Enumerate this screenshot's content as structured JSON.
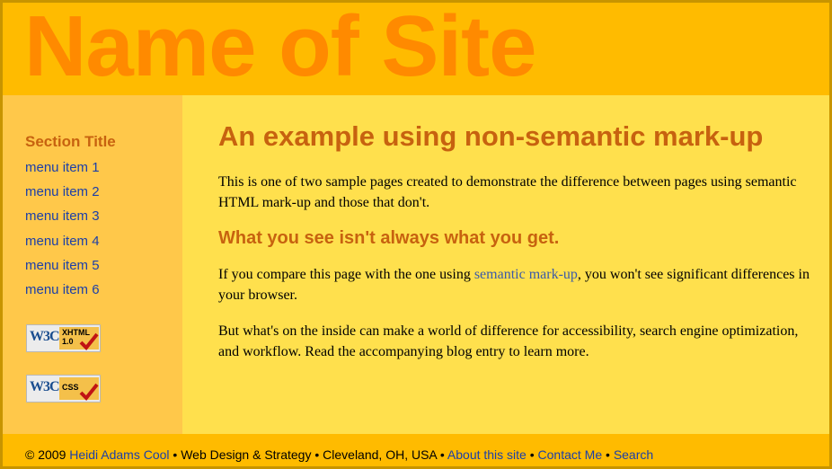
{
  "header": {
    "site_name": "Name of Site"
  },
  "sidebar": {
    "section_title": "Section Title",
    "menu_items": [
      "menu item 1",
      "menu item 2",
      "menu item 3",
      "menu item 4",
      "menu item 5",
      "menu item 6"
    ],
    "badges": [
      {
        "w3c": "W3C",
        "label_line1": "XHTML",
        "label_line2": "1.0"
      },
      {
        "w3c": "W3C",
        "label_line1": "CSS",
        "label_line2": ""
      }
    ]
  },
  "main": {
    "heading": "An example using non-semantic mark-up",
    "para1": "This is one of two sample pages created to demonstrate the difference between pages using semantic HTML mark-up and those that don't.",
    "subheading": "What you see isn't always what you get.",
    "para2_before": "If you compare this page with the one using ",
    "para2_link": "semantic mark-up",
    "para2_after": ", you won't see significant differences in your browser.",
    "para3": "But what's on the inside can make a world of difference for accessibility, search engine optimization, and workflow. Read the accompanying blog entry to learn more."
  },
  "footer": {
    "copyright": "© 2009 ",
    "author_link": "Heidi Adams Cool",
    "text1": " • Web Design & Strategy • Cleveland, OH, USA • ",
    "about_link": "About this site",
    "sep1": " • ",
    "contact_link": "Contact Me",
    "sep2": " • ",
    "search_link": "Search"
  },
  "colors": {
    "header_bg": "#ffbb00",
    "site_name": "#ff8a00",
    "sidebar_bg": "#ffc84a",
    "main_bg": "#ffe04d",
    "heading": "#c7620f",
    "link": "#1c3fa8"
  }
}
